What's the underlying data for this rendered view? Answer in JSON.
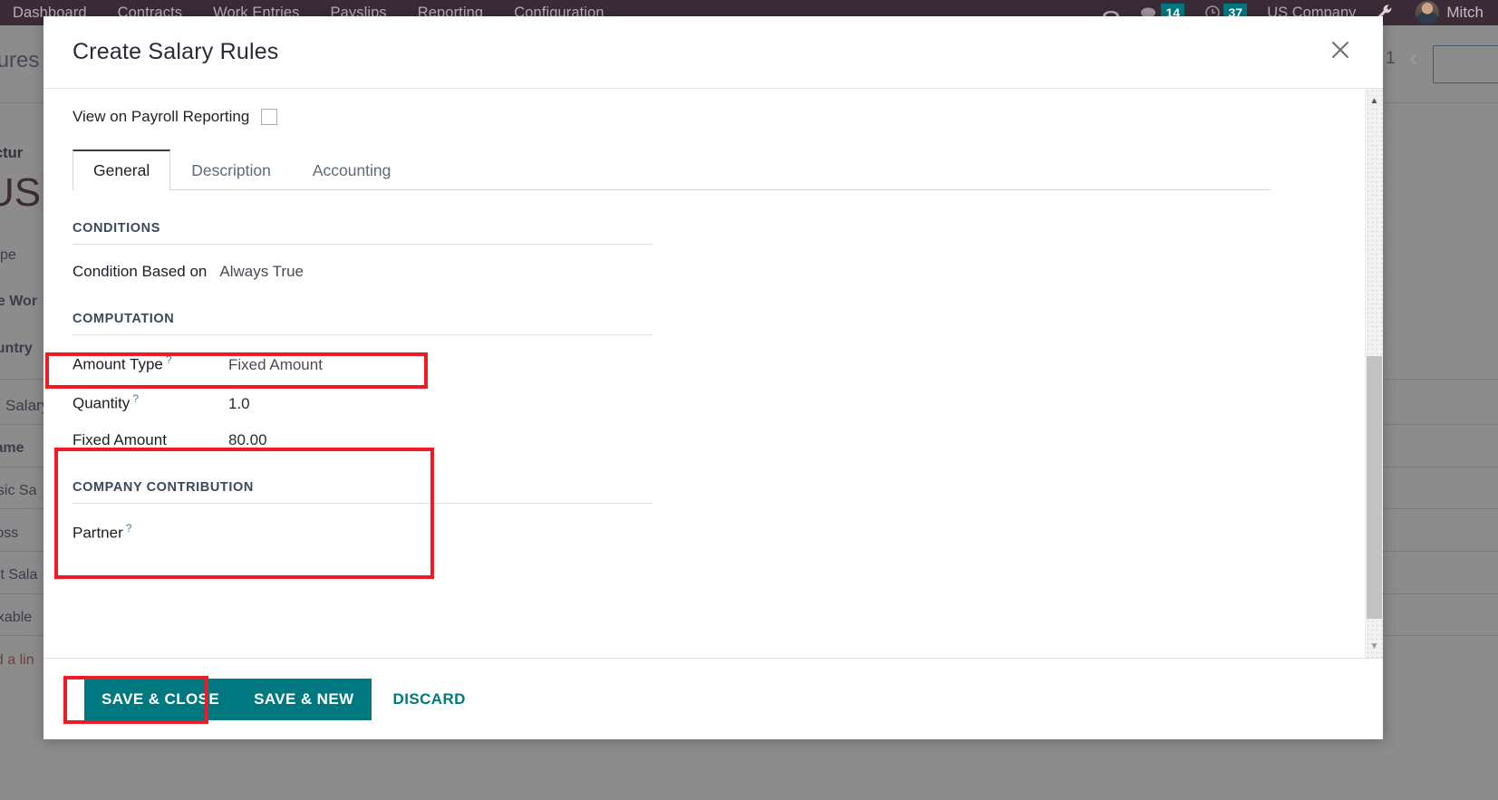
{
  "navbar": {
    "menu": [
      "Dashboard",
      "Contracts",
      "Work Entries",
      "Payslips",
      "Reporting",
      "Configuration"
    ],
    "phone_icon": "phone-icon",
    "messages_icon": "messages-icon",
    "messages_count": "14",
    "activities_icon": "clock-icon",
    "activities_count": "37",
    "company": "US Company",
    "settings_icon": "wrench-icon",
    "username": "Mitch",
    "bg_color": "#3B2B36",
    "badge_color": "#00787F"
  },
  "background": {
    "breadcrumb": "tures",
    "structure_label": "tructur",
    "structure_value": "US",
    "fields": [
      "ype",
      "se Wor",
      "ountry"
    ],
    "table_header": "Salary",
    "rows": [
      "lame",
      "asic Sa",
      "ross",
      "let Sala",
      "axable",
      "dd a lin"
    ],
    "pager_value": "1",
    "pager_prev": "‹",
    "pager_next": "›",
    "trash_icon": "trash-icon"
  },
  "modal": {
    "title": "Create Salary Rules",
    "close_icon": "close-icon",
    "checkbox": {
      "label": "View on Payroll Reporting",
      "checked": false
    },
    "tabs": [
      {
        "label": "General",
        "active": true
      },
      {
        "label": "Description",
        "active": false
      },
      {
        "label": "Accounting",
        "active": false
      }
    ],
    "sections": [
      {
        "title": "CONDITIONS",
        "fields": [
          {
            "label": "Condition Based on",
            "help": false,
            "value": "Always True"
          }
        ]
      },
      {
        "title": "COMPUTATION",
        "fields": [
          {
            "label": "Amount Type",
            "help": true,
            "value": "Fixed Amount"
          },
          {
            "label": "Quantity",
            "help": true,
            "value": "1.0"
          },
          {
            "label": "Fixed Amount",
            "help": false,
            "value": "80.00"
          }
        ]
      },
      {
        "title": "COMPANY CONTRIBUTION",
        "fields": [
          {
            "label": "Partner",
            "help": true,
            "value": ""
          }
        ]
      }
    ],
    "scrollbar": {
      "up_arrow_icon": "scroll-up-icon",
      "down_arrow_icon": "scroll-down-icon"
    },
    "footer": {
      "save_close": "SAVE & CLOSE",
      "save_new": "SAVE & NEW",
      "discard": "DISCARD"
    },
    "highlight_color": "#ee1b24",
    "primary_color": "#00787F"
  }
}
